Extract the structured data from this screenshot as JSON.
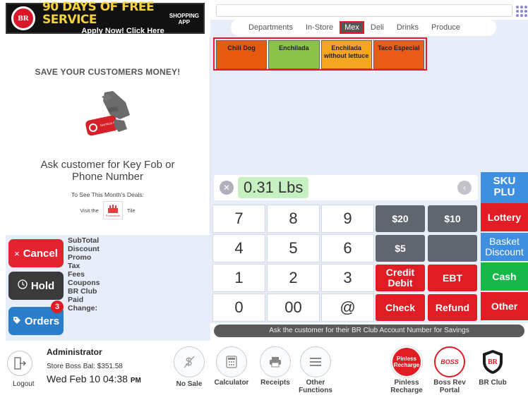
{
  "banner": {
    "logo_text": "BR",
    "title": "90 DAYS OF FREE SERVICE",
    "sub_prefix": "Apply Now!",
    "sub_link": "Click Here",
    "app_label_1": "SHOPPING",
    "app_label_2": "APP"
  },
  "promo": {
    "title": "SAVE YOUR CUSTOMERS MONEY!",
    "ask": "Ask customer for Key Fob or Phone Number",
    "deals": "To See This Month's Deals:",
    "visit_prefix": "Visit the",
    "visit_suffix": "Tile",
    "tile_label": "Promotions",
    "fob_label": "SAVINGS REWARDS"
  },
  "actions": {
    "cancel": "Cancel",
    "hold": "Hold",
    "orders": "Orders",
    "orders_badge": "3"
  },
  "totals": [
    "SubTotal",
    "Discount",
    "Promo",
    "Tax",
    "Fees",
    "Coupons",
    "BR Club",
    "Paid",
    "Change:"
  ],
  "tabs": [
    {
      "label": "Departments"
    },
    {
      "label": "In-Store"
    },
    {
      "label": "Mex"
    },
    {
      "label": "Deli"
    },
    {
      "label": "Drinks"
    },
    {
      "label": "Produce"
    }
  ],
  "items": [
    {
      "label": "Chili Dog",
      "color": "#e85a10"
    },
    {
      "label": "Enchilada",
      "color": "#8ac24a"
    },
    {
      "label": "Enchilada without lettuce",
      "color": "#f4a623"
    },
    {
      "label": "Taco Especial",
      "color": "#ec5a18"
    }
  ],
  "weight": {
    "value": "0.31 Lbs"
  },
  "sku": {
    "line1": "SKU",
    "line2": "PLU"
  },
  "keypad": {
    "k7": "7",
    "k8": "8",
    "k9": "9",
    "k4": "4",
    "k5": "5",
    "k6": "6",
    "k1": "1",
    "k2": "2",
    "k3": "3",
    "k0": "0",
    "k00": "00",
    "kat": "@",
    "d20": "$20",
    "d10": "$10",
    "d5": "$5",
    "credit": "Credit Debit",
    "ebt": "EBT",
    "check": "Check",
    "refund": "Refund",
    "lottery": "Lottery",
    "basket": "Basket Discount",
    "cash": "Cash",
    "other": "Other"
  },
  "notice": "Ask the customer for their BR Club Account Number for Savings",
  "footer": {
    "logout": "Logout",
    "admin": "Administrator",
    "store_bal": "Store Boss Bal: $351.58",
    "date": "Wed Feb 10 04:38",
    "ampm": "PM",
    "no_sale": "No Sale",
    "calculator": "Calculator",
    "receipts": "Receipts",
    "other_functions": "Other Functions",
    "piniless_icon": "Pinless Recharge",
    "piniless": "Pinless Recharge",
    "bossrev": "Boss Rev Portal",
    "bossrev_icon": "BOSS",
    "brclub": "BR Club"
  },
  "colors": {
    "accent_red": "#e01c24",
    "accent_blue": "#3f8fe0",
    "cash_green": "#17b84a",
    "panel_bg": "#e7edf9"
  }
}
